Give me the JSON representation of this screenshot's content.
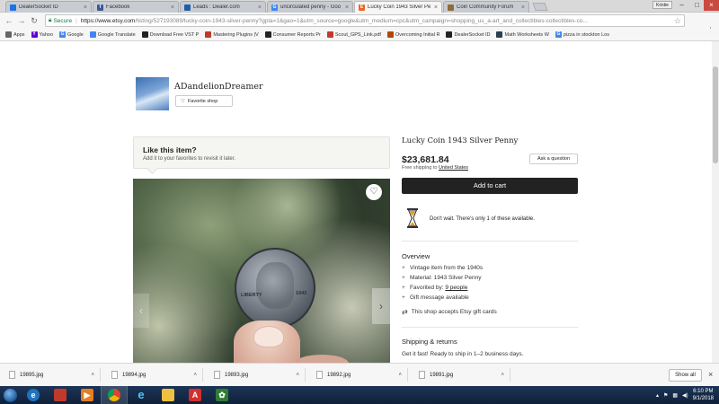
{
  "browser": {
    "tabs": [
      {
        "title": "DealerSocket ID",
        "icon": "dealersocket-icon",
        "color": "#1a73e8",
        "glyph": ""
      },
      {
        "title": "Facebook",
        "icon": "facebook-icon",
        "color": "#3b5998",
        "glyph": "f"
      },
      {
        "title": "Leads : Dealer.com",
        "icon": "dealer-com-icon",
        "color": "#1f5fa8",
        "glyph": ""
      },
      {
        "title": "uncirculated penny - Goo",
        "icon": "google-icon",
        "color": "#4285f4",
        "glyph": "G"
      },
      {
        "title": "Lucky Coin 1943 Silver Pe",
        "icon": "etsy-icon",
        "color": "#f1641e",
        "glyph": "E"
      },
      {
        "title": "Coin Community Forum",
        "icon": "coin-community-icon",
        "color": "#8a6d3b",
        "glyph": ""
      }
    ],
    "window_user": "Kristie",
    "address": {
      "secure_label": "Secure",
      "url_host": "https://www.etsy.com",
      "url_path": "/listing/527193089/lucky-coin-1943-silver-penny?gpla=1&gao=1&utm_source=google&utm_medium=cpc&utm_campaign=shopping_us_a-art_and_collectibles-collectibles-co..."
    },
    "bookmarks": [
      {
        "label": "Apps",
        "icon": "apps-icon",
        "color": "#666"
      },
      {
        "label": "Yahoo",
        "icon": "yahoo-icon",
        "color": "#6001d2"
      },
      {
        "label": "Google",
        "icon": "google-icon",
        "color": "#4285f4"
      },
      {
        "label": "Google Translate",
        "icon": "translate-icon",
        "color": "#4285f4"
      },
      {
        "label": "Download Free VST P",
        "icon": "vst-icon",
        "color": "#222"
      },
      {
        "label": "Mastering Plugins |V",
        "icon": "plugin-icon",
        "color": "#c0392b"
      },
      {
        "label": "Consumer Reports Pr",
        "icon": "consumer-reports-icon",
        "color": "#222"
      },
      {
        "label": "Scout_GPS_Link.pdf",
        "icon": "pdf-icon",
        "color": "#c0392b"
      },
      {
        "label": "Overcoming Initial R",
        "icon": "bookmark-icon",
        "color": "#b34700"
      },
      {
        "label": "DealerSocket ID",
        "icon": "dealersocket-icon",
        "color": "#222"
      },
      {
        "label": "Math Worksheets W",
        "icon": "math-icon",
        "color": "#2c3e50"
      },
      {
        "label": "pizza in stockton Los",
        "icon": "google-icon",
        "color": "#4285f4"
      }
    ]
  },
  "shop": {
    "name": "ADandelionDreamer",
    "favorite_label": "Favorite shop"
  },
  "like_box": {
    "heading": "Like this item?",
    "sub": "Add it to your favorites to revisit it later."
  },
  "photo": {
    "coin_word": "LIBERTY",
    "coin_year": "1943"
  },
  "listing": {
    "title": "Lucky Coin 1943 Silver Penny",
    "price": "$23,681.84",
    "shipping_prefix": "Free shipping to",
    "shipping_dest": "United States",
    "ask_label": "Ask a question",
    "cart_label": "Add to cart",
    "scarcity": "Don't wait. There's only 1 of these available.",
    "overview_heading": "Overview",
    "overview": [
      {
        "text": "Vintage item from the 1940s",
        "link": ""
      },
      {
        "text": "Material: 1943 Silver Penny",
        "link": ""
      },
      {
        "text": "Favorited by: ",
        "link": "9 people"
      },
      {
        "text": "Gift message available",
        "link": ""
      }
    ],
    "gift_cards": "This shop accepts Etsy gift cards",
    "shipping_heading": "Shipping & returns",
    "ship_fast": "Get it fast! Ready to ship in 1–2 business days."
  },
  "downloads": {
    "files": [
      "19895.jpg",
      "19894.jpg",
      "19893.jpg",
      "19892.jpg",
      "19891.jpg"
    ],
    "show_all": "Show all"
  },
  "taskbar": {
    "apps": [
      {
        "icon": "ie-icon",
        "color": "#1e73be",
        "glyph": "e"
      },
      {
        "icon": "shop-icon",
        "color": "#c0392b",
        "glyph": ""
      },
      {
        "icon": "media-player-icon",
        "color": "#e67e22",
        "glyph": "▶"
      },
      {
        "icon": "chrome-icon",
        "color": "#db4437",
        "glyph": ""
      },
      {
        "icon": "internet-explorer-icon",
        "color": "#1e88e5",
        "glyph": "e"
      },
      {
        "icon": "file-explorer-icon",
        "color": "#f0c040",
        "glyph": ""
      },
      {
        "icon": "acrobat-icon",
        "color": "#d32f2f",
        "glyph": "A"
      },
      {
        "icon": "palm-icon",
        "color": "#2e7d32",
        "glyph": "✿"
      }
    ],
    "time": "6:10 PM",
    "date": "9/1/2018"
  }
}
